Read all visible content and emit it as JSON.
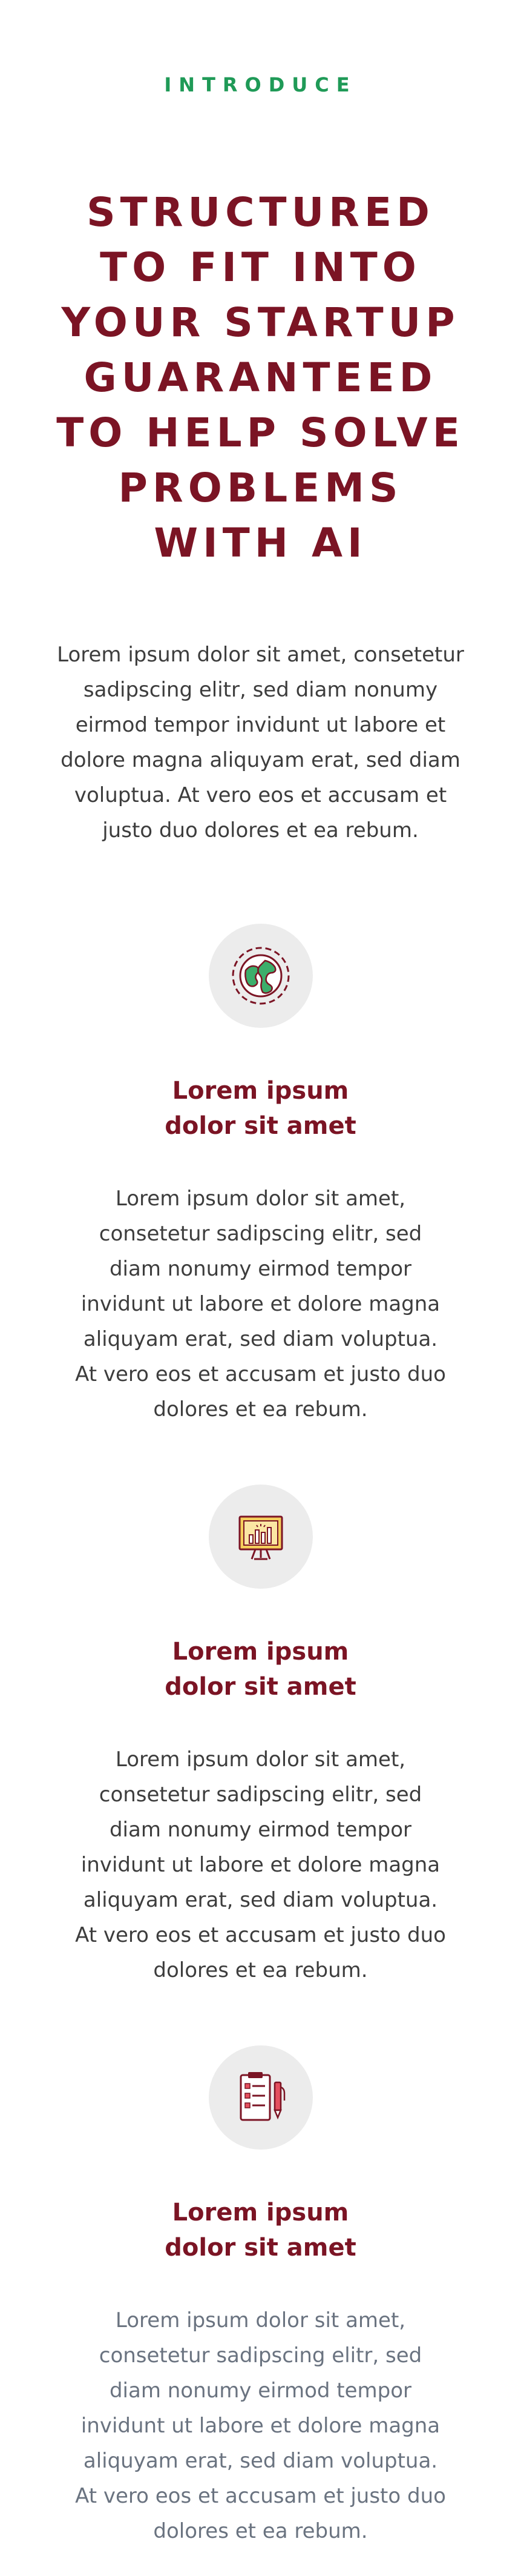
{
  "header": {
    "eyebrow": "INTRODUCE",
    "title": "STRUCTURED TO FIT INTO YOUR STARTUP GUARANTEED TO HELP SOLVE PROBLEMS WITH AI",
    "intro": "Lorem ipsum dolor sit amet, consetetur sadipscing elitr, sed diam nonumy eirmod tempor invidunt ut labore et dolore magna aliquyam erat, sed diam voluptua. At vero eos et accusam et justo duo dolores et ea rebum."
  },
  "features": [
    {
      "icon": "globe-icon",
      "title": "Lorem ipsum dolor sit amet",
      "text": "Lorem ipsum dolor sit amet, consetetur sadipscing elitr, sed diam nonumy eirmod tempor invidunt ut labore et dolore magna aliquyam erat, sed diam voluptua. At vero eos et accusam et justo duo dolores et ea rebum."
    },
    {
      "icon": "presentation-chart-icon",
      "title": "Lorem ipsum dolor sit amet",
      "text": "Lorem ipsum dolor sit amet, consetetur sadipscing elitr, sed diam nonumy eirmod tempor invidunt ut labore et dolore magna aliquyam erat, sed diam voluptua. At vero eos et accusam et justo duo dolores et ea rebum."
    },
    {
      "icon": "clipboard-pen-icon",
      "title": "Lorem ipsum dolor sit amet",
      "text": "Lorem ipsum dolor sit amet, consetetur sadipscing elitr, sed diam nonumy eirmod tempor invidunt ut labore et dolore magna aliquyam erat, sed diam voluptua. At vero eos et accusam et justo duo dolores et ea rebum."
    }
  ],
  "colors": {
    "accent": "#7b1424",
    "eyebrow": "#1f9a57",
    "icon_bg": "#ececec",
    "body_text": "#3d3d3d",
    "muted_text": "#6a7380"
  }
}
